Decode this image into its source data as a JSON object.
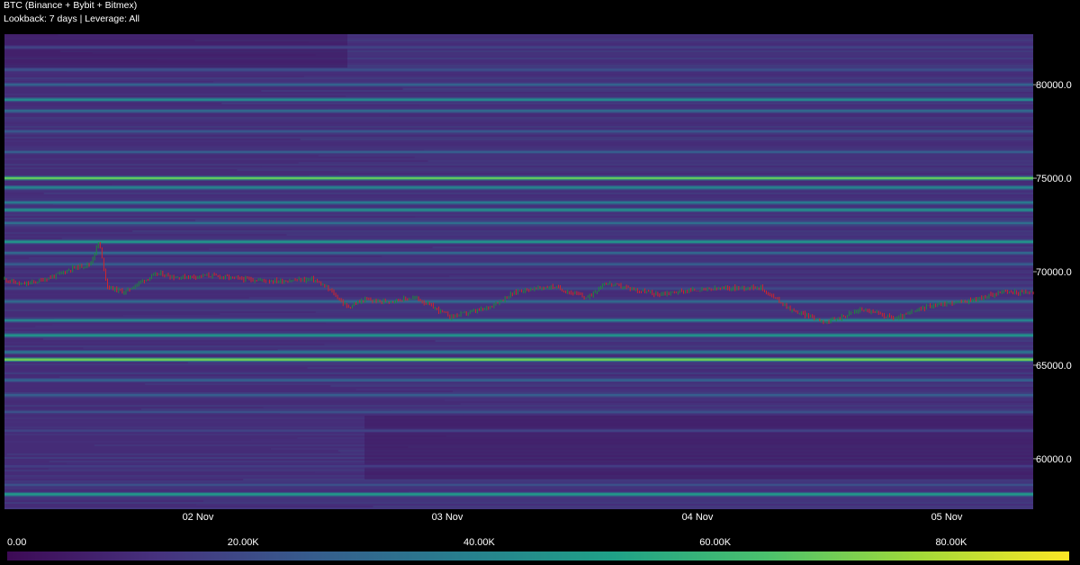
{
  "header": {
    "title": "BTC (Binance + Bybit + Bitmex)",
    "subtitle": "Lookback: 7 days | Leverage: All"
  },
  "colors": {
    "background": "#000000",
    "candle_up": "#1e8a3c",
    "candle_down": "#d0262c",
    "colorscale": [
      "#3d0a55",
      "#46327e",
      "#365c8d",
      "#277f8e",
      "#1fa187",
      "#4ac16d",
      "#a0da39",
      "#fde725"
    ]
  },
  "chart_data": {
    "type": "heatmap",
    "title": "BTC (Binance + Bybit + Bitmex)",
    "subtitle": "Lookback: 7 days | Leverage: All",
    "ylim": [
      57300,
      82700
    ],
    "x_ticks": [
      "02 Nov",
      "03 Nov",
      "04 Nov",
      "05 Nov"
    ],
    "y_ticks": [
      {
        "value": 80000,
        "label": "80000.0"
      },
      {
        "value": 75000,
        "label": "75000.0"
      },
      {
        "value": 70000,
        "label": "70000.0"
      },
      {
        "value": 65000,
        "label": "65000.0"
      },
      {
        "value": 60000,
        "label": "60000.0"
      }
    ],
    "colorbar": {
      "min": 0,
      "max": 90000,
      "ticks": [
        {
          "value": 0,
          "label": "0.00"
        },
        {
          "value": 20000,
          "label": "20.00K"
        },
        {
          "value": 40000,
          "label": "40.00K"
        },
        {
          "value": 60000,
          "label": "60.00K"
        },
        {
          "value": 80000,
          "label": "80.00K"
        }
      ]
    },
    "liquidation_bands": [
      {
        "price": 82000,
        "intensity": 18000
      },
      {
        "price": 80800,
        "intensity": 22000
      },
      {
        "price": 80000,
        "intensity": 28000
      },
      {
        "price": 79200,
        "intensity": 42000
      },
      {
        "price": 78600,
        "intensity": 30000
      },
      {
        "price": 77500,
        "intensity": 24000
      },
      {
        "price": 76400,
        "intensity": 26000
      },
      {
        "price": 75000,
        "intensity": 68000
      },
      {
        "price": 74500,
        "intensity": 40000
      },
      {
        "price": 73700,
        "intensity": 36000
      },
      {
        "price": 73300,
        "intensity": 44000
      },
      {
        "price": 72600,
        "intensity": 32000
      },
      {
        "price": 71600,
        "intensity": 46000
      },
      {
        "price": 71000,
        "intensity": 30000
      },
      {
        "price": 70400,
        "intensity": 26000
      },
      {
        "price": 69100,
        "intensity": 20000
      },
      {
        "price": 68400,
        "intensity": 30000
      },
      {
        "price": 67400,
        "intensity": 40000
      },
      {
        "price": 66600,
        "intensity": 46000
      },
      {
        "price": 65700,
        "intensity": 34000
      },
      {
        "price": 65300,
        "intensity": 70000
      },
      {
        "price": 64200,
        "intensity": 28000
      },
      {
        "price": 63400,
        "intensity": 26000
      },
      {
        "price": 62500,
        "intensity": 22000
      },
      {
        "price": 61500,
        "intensity": 18000
      },
      {
        "price": 59600,
        "intensity": 16000
      },
      {
        "price": 58600,
        "intensity": 22000
      },
      {
        "price": 58100,
        "intensity": 48000
      }
    ],
    "price_series": {
      "name": "",
      "x": [
        0,
        0.1,
        0.2,
        0.3,
        0.4,
        0.5,
        0.55,
        0.6,
        0.7,
        0.8,
        0.9,
        1.0,
        1.2,
        1.4,
        1.6,
        1.8,
        1.9,
        2.0,
        2.1,
        2.2,
        2.4,
        2.6,
        2.8,
        3.0,
        3.2,
        3.4,
        3.5,
        3.6,
        3.8,
        4.0,
        4.2,
        4.4,
        4.6,
        4.8,
        5.0,
        5.2,
        5.4,
        5.6,
        5.7,
        5.8,
        6.0
      ],
      "y": [
        69600,
        69300,
        69500,
        69800,
        70200,
        70400,
        71600,
        69200,
        68900,
        69500,
        69900,
        69700,
        69800,
        69600,
        69500,
        69600,
        69000,
        68100,
        68500,
        68400,
        68600,
        67600,
        68000,
        69000,
        69200,
        68600,
        69400,
        69200,
        68800,
        69000,
        69100,
        69200,
        67900,
        67300,
        68000,
        67500,
        68200,
        68400,
        68600,
        68900,
        68900
      ]
    }
  }
}
